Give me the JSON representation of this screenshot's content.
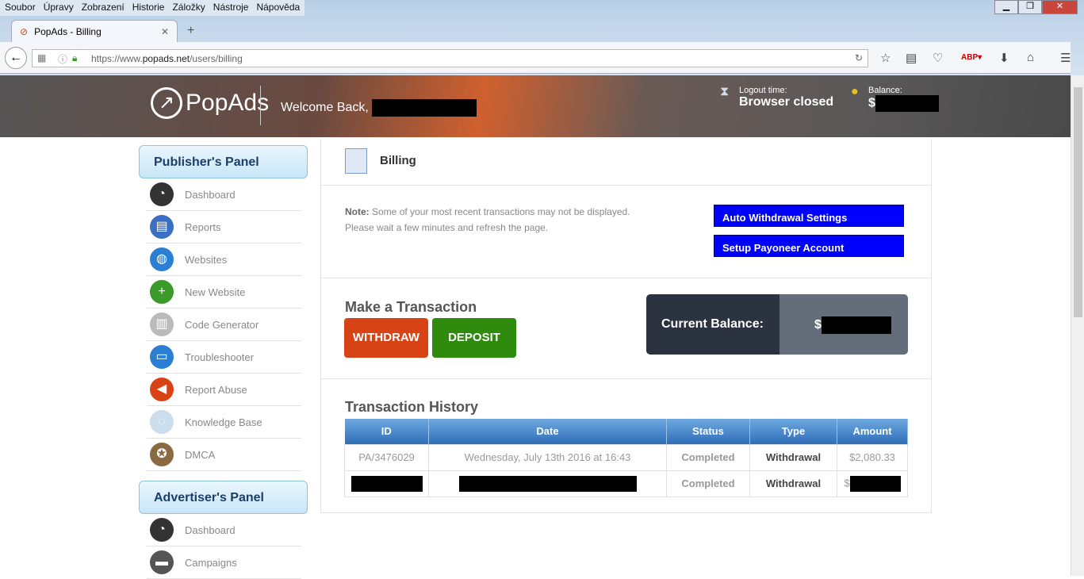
{
  "browser": {
    "menu": [
      "Soubor",
      "Úpravy",
      "Zobrazení",
      "Historie",
      "Záložky",
      "Nástroje",
      "Nápověda"
    ],
    "tab_title": "PopAds - Billing",
    "url_prefix": "https://www.",
    "url_domain": "popads.net",
    "url_path": "/users/billing"
  },
  "header": {
    "logo": "PopAds",
    "welcome": "Welcome Back,",
    "logout_label": "Logout time:",
    "logout_value": "Browser closed",
    "balance_label": "Balance:",
    "balance_currency": "$"
  },
  "sidebar": {
    "publisher_title": "Publisher's Panel",
    "publisher_items": [
      {
        "label": "Dashboard",
        "icon": "gauge-icon"
      },
      {
        "label": "Reports",
        "icon": "report-icon"
      },
      {
        "label": "Websites",
        "icon": "globe-icon"
      },
      {
        "label": "New Website",
        "icon": "plus-icon"
      },
      {
        "label": "Code Generator",
        "icon": "code-icon"
      },
      {
        "label": "Troubleshooter",
        "icon": "monitor-icon"
      },
      {
        "label": "Report Abuse",
        "icon": "megaphone-icon"
      },
      {
        "label": "Knowledge Base",
        "icon": "lightbulb-icon"
      },
      {
        "label": "DMCA",
        "icon": "seal-icon"
      }
    ],
    "advertiser_title": "Advertiser's Panel",
    "advertiser_items": [
      {
        "label": "Dashboard",
        "icon": "gauge-icon"
      },
      {
        "label": "Campaigns",
        "icon": "wallet-icon"
      }
    ]
  },
  "main": {
    "title": "Billing",
    "note_label": "Note:",
    "note_text": " Some of your most recent transactions may not be displayed.",
    "note_text2": "Please wait a few minutes and refresh the page.",
    "auto_withdrawal": "Auto Withdrawal Settings",
    "payoneer": "Setup Payoneer Account",
    "transaction_title": "Make a Transaction",
    "withdraw": "WITHDRAW",
    "deposit": "DEPOSIT",
    "current_balance_label": "Current Balance:",
    "current_balance_currency": "$",
    "history_title": "Transaction History",
    "columns": [
      "ID",
      "Date",
      "Status",
      "Type",
      "Amount"
    ],
    "rows": [
      {
        "id": "PA/3476029",
        "date": "Wednesday, July 13th 2016 at 16:43",
        "status": "Completed",
        "type": "Withdrawal",
        "amount": "$2,080.33"
      },
      {
        "status": "Completed",
        "type": "Withdrawal",
        "amount_currency": "$"
      }
    ]
  },
  "colors": {
    "withdraw": "#d84315",
    "deposit": "#2e8b0e",
    "blue_button": "#0000ff"
  }
}
